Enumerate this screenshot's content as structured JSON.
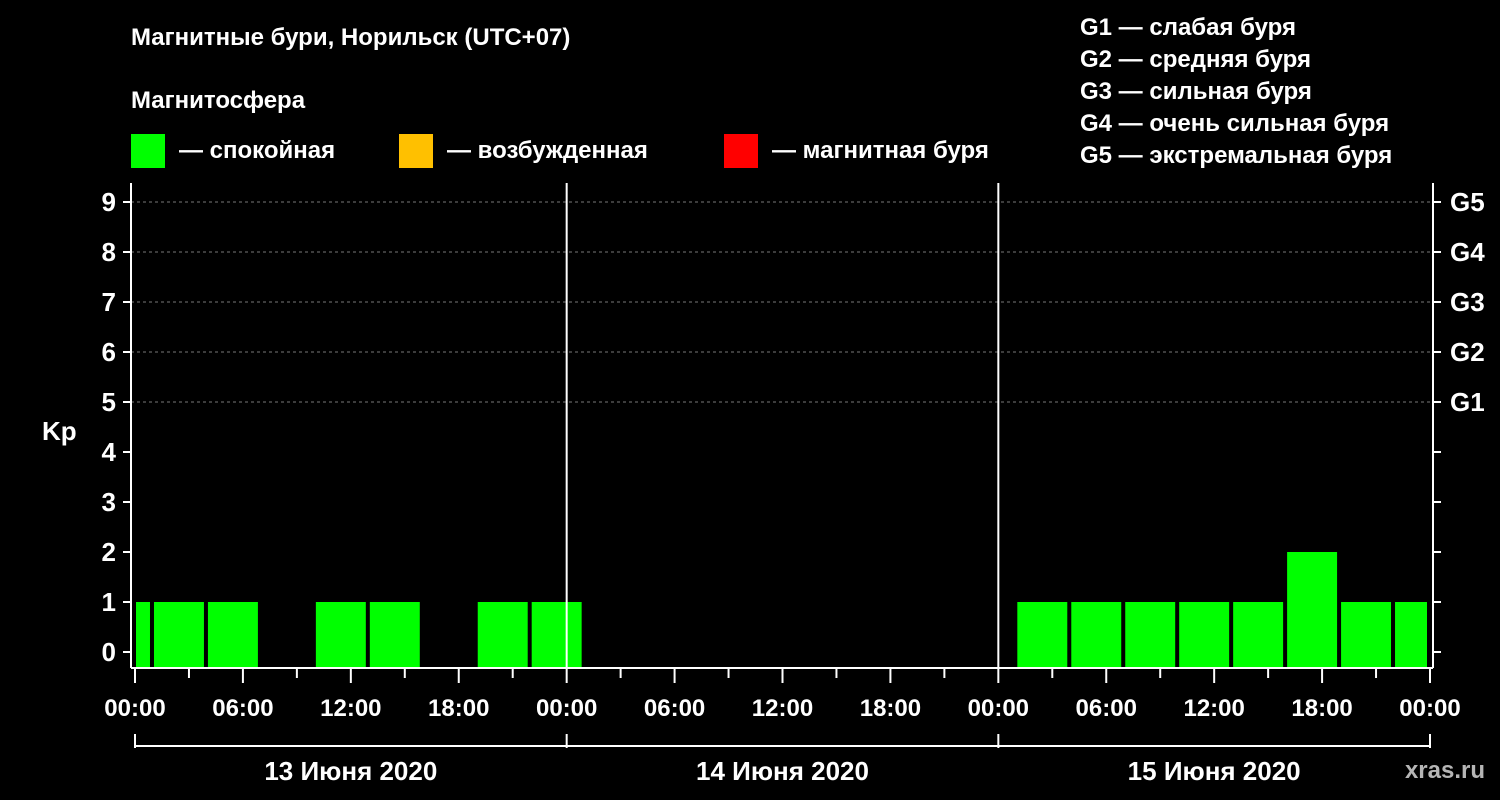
{
  "header": {
    "title": "Магнитные бури, Норильск (UTC+07)",
    "subtitle": "Магнитосфера"
  },
  "legend": [
    {
      "label": "— спокойная",
      "color": "#00ff00"
    },
    {
      "label": "— возбужденная",
      "color": "#ffc000"
    },
    {
      "label": "— магнитная буря",
      "color": "#ff0000"
    }
  ],
  "g_legend": [
    "G1 — слабая буря",
    "G2 — средняя буря",
    "G3 — сильная буря",
    "G4 — очень сильная буря",
    "G5 — экстремальная буря"
  ],
  "watermark": "xras.ru",
  "chart_data": {
    "type": "bar",
    "ylabel": "Kp",
    "ylim": [
      0,
      9
    ],
    "yticks": [
      "0",
      "1",
      "2",
      "3",
      "4",
      "5",
      "6",
      "7",
      "8",
      "9"
    ],
    "right_ticks": [
      {
        "value": 5,
        "label": "G1"
      },
      {
        "value": 6,
        "label": "G2"
      },
      {
        "value": 7,
        "label": "G3"
      },
      {
        "value": 8,
        "label": "G4"
      },
      {
        "value": 9,
        "label": "G5"
      }
    ],
    "x_time_labels": [
      "00:00",
      "06:00",
      "12:00",
      "18:00",
      "00:00",
      "06:00",
      "12:00",
      "18:00",
      "00:00",
      "06:00",
      "12:00",
      "18:00",
      "00:00"
    ],
    "days": [
      "13 Июня 2020",
      "14 Июня 2020",
      "15 Июня 2020"
    ],
    "grid": "dashed horizontal at Kp 5-9",
    "bar_color": "#00ff00",
    "bars": [
      {
        "start_hour": 0,
        "end_hour": 1,
        "kp": 1
      },
      {
        "start_hour": 1,
        "end_hour": 4,
        "kp": 1
      },
      {
        "start_hour": 4,
        "end_hour": 7,
        "kp": 1
      },
      {
        "start_hour": 10,
        "end_hour": 13,
        "kp": 1
      },
      {
        "start_hour": 13,
        "end_hour": 16,
        "kp": 1
      },
      {
        "start_hour": 19,
        "end_hour": 22,
        "kp": 1
      },
      {
        "start_hour": 22,
        "end_hour": 25,
        "kp": 1
      },
      {
        "start_hour": 49,
        "end_hour": 52,
        "kp": 1
      },
      {
        "start_hour": 52,
        "end_hour": 55,
        "kp": 1
      },
      {
        "start_hour": 55,
        "end_hour": 58,
        "kp": 1
      },
      {
        "start_hour": 58,
        "end_hour": 61,
        "kp": 1
      },
      {
        "start_hour": 61,
        "end_hour": 64,
        "kp": 1
      },
      {
        "start_hour": 64,
        "end_hour": 67,
        "kp": 2
      },
      {
        "start_hour": 67,
        "end_hour": 70,
        "kp": 1
      },
      {
        "start_hour": 70,
        "end_hour": 72,
        "kp": 1
      }
    ]
  }
}
